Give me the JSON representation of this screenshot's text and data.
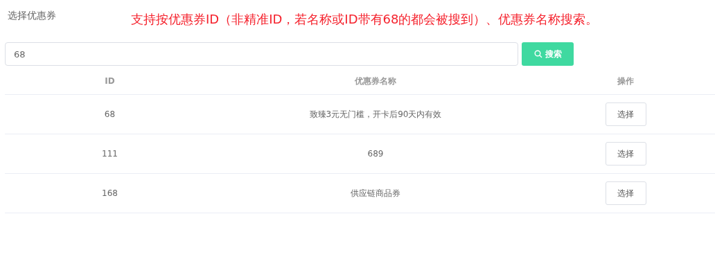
{
  "title": "选择优惠券",
  "note": "支持按优惠券ID（非精准ID，若名称或ID带有68的都会被搜到）、优惠券名称搜索。",
  "search": {
    "value": "68",
    "button": "搜索"
  },
  "table": {
    "columns": [
      "ID",
      "优惠券名称",
      "操作"
    ],
    "rows": [
      {
        "id": "68",
        "name": "致臻3元无门槛，开卡后90天内有效",
        "action": "选择"
      },
      {
        "id": "111",
        "name": "689",
        "action": "选择"
      },
      {
        "id": "168",
        "name": "供应链商品券",
        "action": "选择"
      }
    ]
  }
}
